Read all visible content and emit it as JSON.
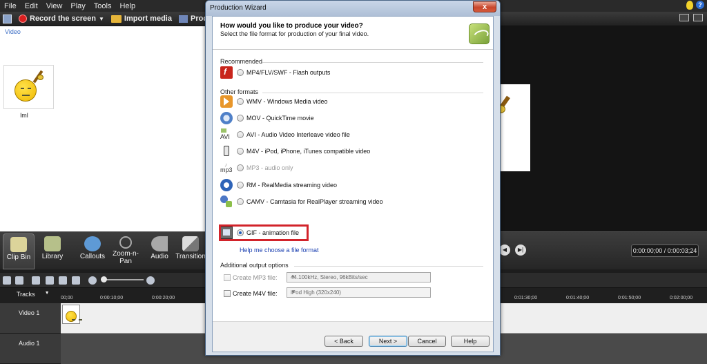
{
  "menu": [
    "File",
    "Edit",
    "View",
    "Play",
    "Tools",
    "Help"
  ],
  "toolbar": {
    "record": "Record the screen",
    "import": "Import media",
    "produce": "Produc"
  },
  "clip_bin": {
    "header": "Video",
    "clip_name": "lml"
  },
  "tabs": [
    "Clip Bin",
    "Library",
    "Callouts",
    "Zoom-n-\nPan",
    "Audio",
    "Transition"
  ],
  "timecode": "0:00:00;00 / 0:00:03;24",
  "timeline": {
    "tracks_label": "Tracks",
    "ruler": [
      "00;00",
      "0:00:10;00",
      "0:00:20;00",
      "0:01:30;00",
      "0:01:40;00",
      "0:01:50;00",
      "0:02:00;00"
    ],
    "video_track": "Video 1",
    "audio_track": "Audio 1"
  },
  "dialog": {
    "title": "Production Wizard",
    "close": "x",
    "question": "How would you like to produce your video?",
    "subtitle": "Select the file format for production of your final video.",
    "recommended_label": "Recommended",
    "recommended": [
      {
        "label": "MP4/FLV/SWF - Flash outputs",
        "icon": "flash-icon",
        "selected": false,
        "enabled": true
      }
    ],
    "other_label": "Other formats",
    "formats": [
      {
        "label": "WMV - Windows Media video",
        "icon": "wmv-icon",
        "selected": false,
        "enabled": true
      },
      {
        "label": "MOV - QuickTime movie",
        "icon": "quicktime-icon",
        "selected": false,
        "enabled": true
      },
      {
        "label": "AVI - Audio Video Interleave video file",
        "icon": "avi-icon",
        "icon_text": "AVI",
        "selected": false,
        "enabled": true
      },
      {
        "label": "M4V - iPod, iPhone, iTunes compatible video",
        "icon": "ipod-icon",
        "selected": false,
        "enabled": true
      },
      {
        "label": "MP3 - audio only",
        "icon": "mp3-icon",
        "icon_text": "mp3",
        "selected": false,
        "enabled": false
      },
      {
        "label": "RM - RealMedia streaming video",
        "icon": "realmedia-icon",
        "selected": false,
        "enabled": true
      },
      {
        "label": "CAMV - Camtasia for RealPlayer streaming video",
        "icon": "camv-icon",
        "selected": false,
        "enabled": true
      },
      {
        "label": "GIF - animation file",
        "icon": "gif-icon",
        "selected": true,
        "enabled": true
      }
    ],
    "help_link": "Help me choose a file format",
    "additional_label": "Additional output options",
    "create_mp3": {
      "label": "Create MP3 file:",
      "value": "44.100kHz, Stereo, 96kBits/sec",
      "checked": false,
      "enabled": false
    },
    "create_m4v": {
      "label": "Create M4V file:",
      "value": "iPod High (320x240)",
      "checked": false,
      "enabled": true
    },
    "buttons": {
      "back": "< Back",
      "next": "Next >",
      "cancel": "Cancel",
      "help": "Help"
    },
    "highlight_color": "#d2232a"
  }
}
